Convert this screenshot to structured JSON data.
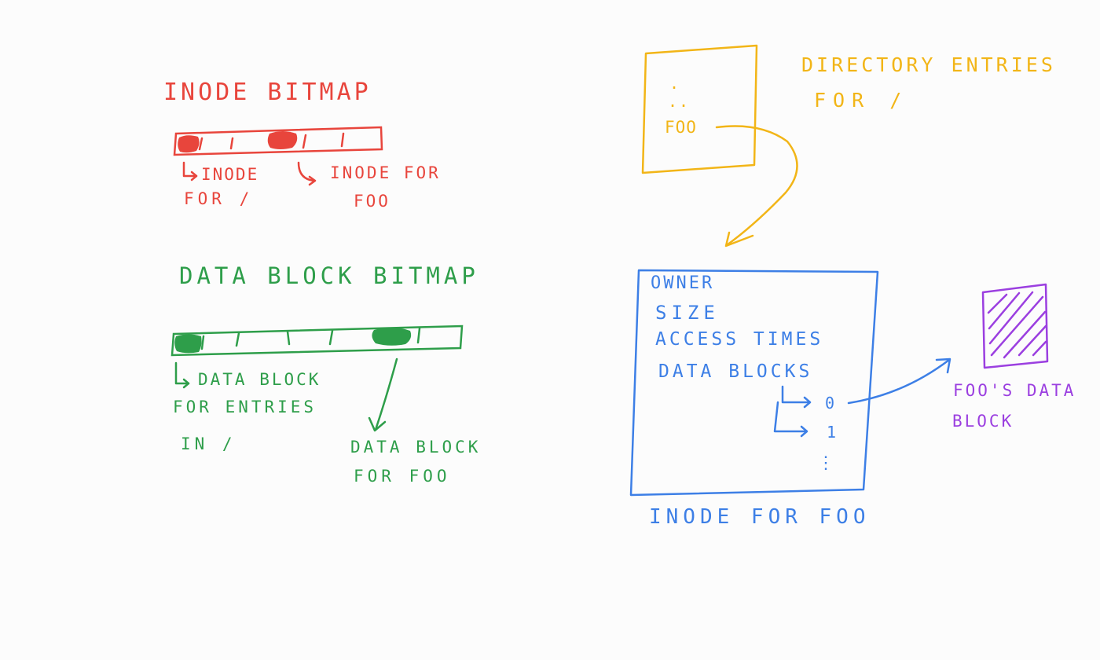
{
  "inode_bitmap": {
    "title": "INODE BITMAP",
    "root_label_line1": "INODE",
    "root_label_line2": "FOR /",
    "foo_label_line1": "INODE FOR",
    "foo_label_line2": "FOO",
    "color": "#e8453c"
  },
  "data_bitmap": {
    "title": "DATA BLOCK BITMAP",
    "root_label_line1": "DATA BLOCK",
    "root_label_line2": "FOR ENTRIES",
    "root_label_line3": "IN /",
    "foo_label_line1": "DATA BLOCK",
    "foo_label_line2": "FOR FOO",
    "color": "#2e9e4a"
  },
  "directory": {
    "title_line1": "DIRECTORY ENTRIES",
    "title_line2": "FOR /",
    "entry_dot": ".",
    "entry_dotdot": "..",
    "entry_foo": "FOO",
    "color": "#f2b517"
  },
  "inode_foo": {
    "field_owner": "OWNER",
    "field_size": "SIZE",
    "field_access": "ACCESS TIMES",
    "field_blocks": "DATA BLOCKS",
    "block_0": "0",
    "block_1": "1",
    "block_more": "⋮",
    "caption": "INODE FOR FOO",
    "color": "#3d7fe6"
  },
  "foo_data_block": {
    "label_line1": "FOO'S DATA",
    "label_line2": "BLOCK",
    "color": "#9b3fe0"
  }
}
